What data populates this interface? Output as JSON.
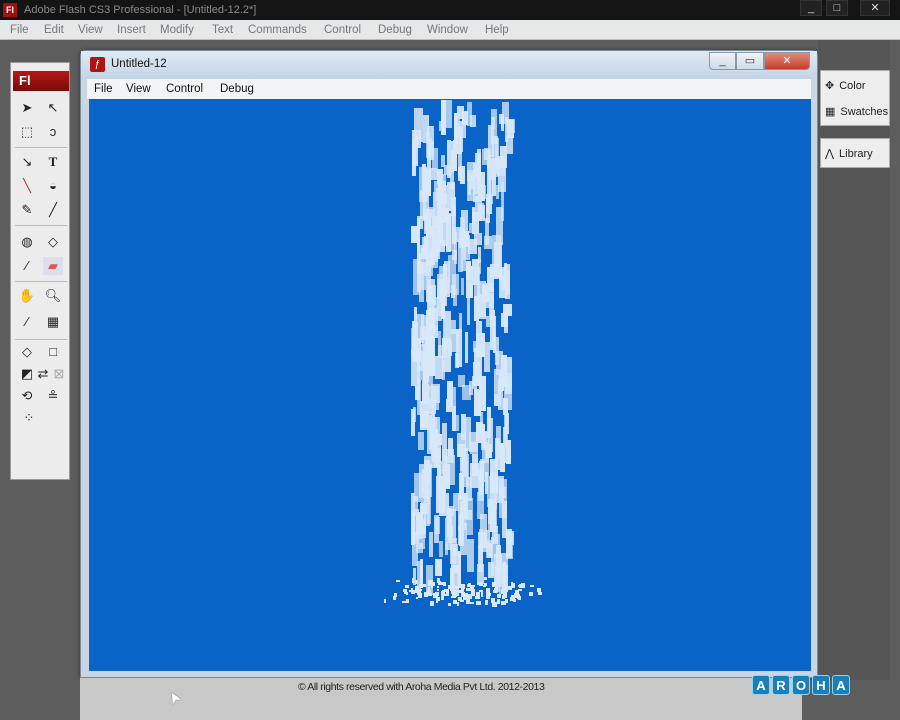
{
  "app": {
    "title": "Adobe Flash CS3 Professional - [Untitled-12.2*]",
    "logo": "Fl"
  },
  "menu": [
    "File",
    "Edit",
    "View",
    "Insert",
    "Modify",
    "Text",
    "Commands",
    "Control",
    "Debug",
    "Window",
    "Help"
  ],
  "player": {
    "title": "Untitled-12",
    "menu": [
      "File",
      "View",
      "Control",
      "Debug"
    ],
    "stage_color": "#0a64c8"
  },
  "panels": {
    "color": "Color",
    "swatches": "Swatches",
    "library": "Library"
  },
  "footer": {
    "copyright": "© All rights reserved with Aroha Media Pvt Ltd. 2012-2013",
    "brand": [
      "A",
      "R",
      "O",
      "H",
      "A"
    ]
  }
}
